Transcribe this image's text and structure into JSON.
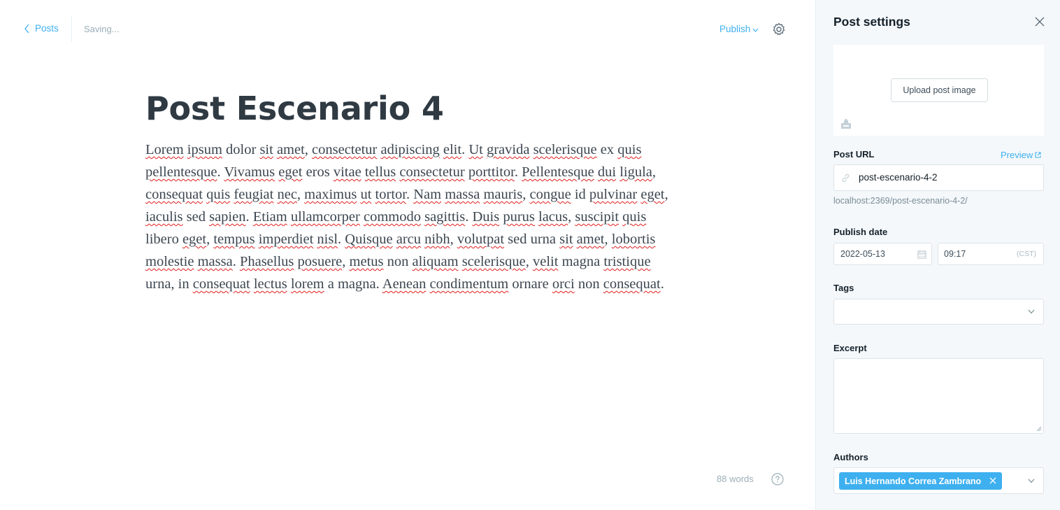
{
  "header": {
    "back_label": "Posts",
    "status": "Saving...",
    "publish_label": "Publish"
  },
  "editor": {
    "title": "Post Escenario 4",
    "word_count": "88 words"
  },
  "body_words": [
    {
      "t": "Lorem",
      "s": true
    },
    {
      "t": " "
    },
    {
      "t": "ipsum",
      "s": true
    },
    {
      "t": " dolor "
    },
    {
      "t": "sit",
      "s": true
    },
    {
      "t": " "
    },
    {
      "t": "amet",
      "s": true
    },
    {
      "t": ", "
    },
    {
      "t": "consectetur",
      "s": true
    },
    {
      "t": " "
    },
    {
      "t": "adipiscing",
      "s": true
    },
    {
      "t": " "
    },
    {
      "t": "elit",
      "s": true
    },
    {
      "t": ". "
    },
    {
      "t": "Ut",
      "s": true
    },
    {
      "t": " "
    },
    {
      "t": "gravida",
      "s": true
    },
    {
      "t": " "
    },
    {
      "t": "scelerisque",
      "s": true
    },
    {
      "t": " ex "
    },
    {
      "t": "quis",
      "s": true
    },
    {
      "t": " "
    },
    {
      "t": "pellentesque",
      "s": true
    },
    {
      "t": ". "
    },
    {
      "t": "Vivamus",
      "s": true
    },
    {
      "t": " "
    },
    {
      "t": "eget",
      "s": true
    },
    {
      "t": " eros "
    },
    {
      "t": "vitae",
      "s": true
    },
    {
      "t": " "
    },
    {
      "t": "tellus",
      "s": true
    },
    {
      "t": " "
    },
    {
      "t": "consectetur",
      "s": true
    },
    {
      "t": " "
    },
    {
      "t": "porttitor",
      "s": true
    },
    {
      "t": ". "
    },
    {
      "t": "Pellentesque",
      "s": true
    },
    {
      "t": " "
    },
    {
      "t": "dui",
      "s": true
    },
    {
      "t": " "
    },
    {
      "t": "ligula",
      "s": true
    },
    {
      "t": ", "
    },
    {
      "t": "consequat",
      "s": true
    },
    {
      "t": " "
    },
    {
      "t": "quis",
      "s": true
    },
    {
      "t": " "
    },
    {
      "t": "feugiat",
      "s": true
    },
    {
      "t": " "
    },
    {
      "t": "nec",
      "s": true
    },
    {
      "t": ", "
    },
    {
      "t": "maximus",
      "s": true
    },
    {
      "t": " "
    },
    {
      "t": "ut",
      "s": true
    },
    {
      "t": " "
    },
    {
      "t": "tortor",
      "s": true
    },
    {
      "t": ". "
    },
    {
      "t": "Nam",
      "s": true
    },
    {
      "t": " "
    },
    {
      "t": "massa",
      "s": true
    },
    {
      "t": " "
    },
    {
      "t": "mauris",
      "s": true
    },
    {
      "t": ", "
    },
    {
      "t": "congue",
      "s": true
    },
    {
      "t": " id "
    },
    {
      "t": "pulvinar",
      "s": true
    },
    {
      "t": " "
    },
    {
      "t": "eget",
      "s": true
    },
    {
      "t": ", "
    },
    {
      "t": "iaculis",
      "s": true
    },
    {
      "t": " sed "
    },
    {
      "t": "sapien",
      "s": true
    },
    {
      "t": ". "
    },
    {
      "t": "Etiam",
      "s": true
    },
    {
      "t": " "
    },
    {
      "t": "ullamcorper",
      "s": true
    },
    {
      "t": " "
    },
    {
      "t": "commodo",
      "s": true
    },
    {
      "t": " "
    },
    {
      "t": "sagittis",
      "s": true
    },
    {
      "t": ". "
    },
    {
      "t": "Duis",
      "s": true
    },
    {
      "t": " "
    },
    {
      "t": "purus",
      "s": true
    },
    {
      "t": " "
    },
    {
      "t": "lacus",
      "s": true
    },
    {
      "t": ", "
    },
    {
      "t": "suscipit",
      "s": true
    },
    {
      "t": " "
    },
    {
      "t": "quis",
      "s": true
    },
    {
      "t": " "
    },
    {
      "t": "libero "
    },
    {
      "t": "eget",
      "s": true
    },
    {
      "t": ", "
    },
    {
      "t": "tempus",
      "s": true
    },
    {
      "t": " "
    },
    {
      "t": "imperdiet",
      "s": true
    },
    {
      "t": " "
    },
    {
      "t": "nisl",
      "s": true
    },
    {
      "t": ". "
    },
    {
      "t": "Quisque",
      "s": true
    },
    {
      "t": " "
    },
    {
      "t": "arcu",
      "s": true
    },
    {
      "t": " "
    },
    {
      "t": "nibh",
      "s": true
    },
    {
      "t": ", "
    },
    {
      "t": "volutpat",
      "s": true
    },
    {
      "t": " sed urna "
    },
    {
      "t": "sit",
      "s": true
    },
    {
      "t": " "
    },
    {
      "t": "amet",
      "s": true
    },
    {
      "t": ", "
    },
    {
      "t": "lobortis",
      "s": true
    },
    {
      "t": " "
    },
    {
      "t": "molestie",
      "s": true
    },
    {
      "t": " "
    },
    {
      "t": "massa",
      "s": true
    },
    {
      "t": ". "
    },
    {
      "t": "Phasellus",
      "s": true
    },
    {
      "t": " "
    },
    {
      "t": "posuere",
      "s": true
    },
    {
      "t": ", "
    },
    {
      "t": "metus",
      "s": true
    },
    {
      "t": " non "
    },
    {
      "t": "aliquam",
      "s": true
    },
    {
      "t": " "
    },
    {
      "t": "scelerisque",
      "s": true
    },
    {
      "t": ", "
    },
    {
      "t": "velit",
      "s": true
    },
    {
      "t": " magna "
    },
    {
      "t": "tristique",
      "s": true
    },
    {
      "t": " "
    },
    {
      "t": "urna, in "
    },
    {
      "t": "consequat",
      "s": true
    },
    {
      "t": " "
    },
    {
      "t": "lectus",
      "s": true
    },
    {
      "t": " "
    },
    {
      "t": "lorem",
      "s": true
    },
    {
      "t": " a magna. "
    },
    {
      "t": "Aenean",
      "s": true
    },
    {
      "t": " "
    },
    {
      "t": "condimentum",
      "s": true
    },
    {
      "t": " ornare "
    },
    {
      "t": "orci",
      "s": true
    },
    {
      "t": " non "
    },
    {
      "t": "consequat",
      "s": true
    },
    {
      "t": "."
    }
  ],
  "settings": {
    "title": "Post settings",
    "upload_label": "Upload post image",
    "url_label": "Post URL",
    "preview_label": "Preview",
    "url_value": "post-escenario-4-2",
    "url_hint": "localhost:2369/post-escenario-4-2/",
    "publish_date_label": "Publish date",
    "date_value": "2022-05-13",
    "time_value": "09:17",
    "timezone": "(CST)",
    "tags_label": "Tags",
    "excerpt_label": "Excerpt",
    "authors_label": "Authors",
    "author_name": "Luis Hernando Correa Zambrano"
  },
  "colors": {
    "accent": "#3eb0ef",
    "sidebar_bg": "#f4f8fb",
    "spellcheck": "#e11d1d"
  },
  "icons": [
    "chevron-left-icon",
    "chevron-down-icon",
    "gear-icon",
    "help-icon",
    "close-icon",
    "image-icon",
    "link-icon",
    "external-link-icon",
    "calendar-icon",
    "remove-icon"
  ]
}
